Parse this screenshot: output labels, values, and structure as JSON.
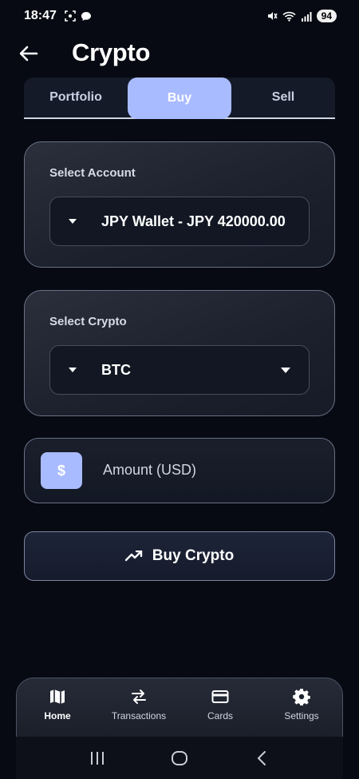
{
  "status_bar": {
    "time": "18:47",
    "battery": "94",
    "left_icons": [
      "screenshot-icon",
      "chat-bubble-icon"
    ],
    "right_icons": [
      "mute-icon",
      "wifi-icon",
      "signal-icon"
    ]
  },
  "header": {
    "title": "Crypto",
    "back_icon": "arrow-left-icon"
  },
  "tabs": [
    {
      "label": "Portfolio",
      "active": false
    },
    {
      "label": "Buy",
      "active": true
    },
    {
      "label": "Sell",
      "active": false
    }
  ],
  "account_card": {
    "label": "Select Account",
    "selected": "JPY Wallet - JPY 420000.00"
  },
  "crypto_card": {
    "label": "Select Crypto",
    "selected": "BTC"
  },
  "amount": {
    "icon_glyph": "$",
    "placeholder": "Amount (USD)"
  },
  "buy_button": {
    "label": "Buy Crypto",
    "icon": "trending-up-icon"
  },
  "bottom_nav": [
    {
      "label": "Home",
      "icon": "map-icon",
      "active": true
    },
    {
      "label": "Transactions",
      "icon": "swap-icon",
      "active": false
    },
    {
      "label": "Cards",
      "icon": "card-icon",
      "active": false
    },
    {
      "label": "Settings",
      "icon": "gear-icon",
      "active": false
    }
  ],
  "colors": {
    "accent": "#a9bbff",
    "background": "#070a12",
    "card_border": "#6a7186"
  }
}
